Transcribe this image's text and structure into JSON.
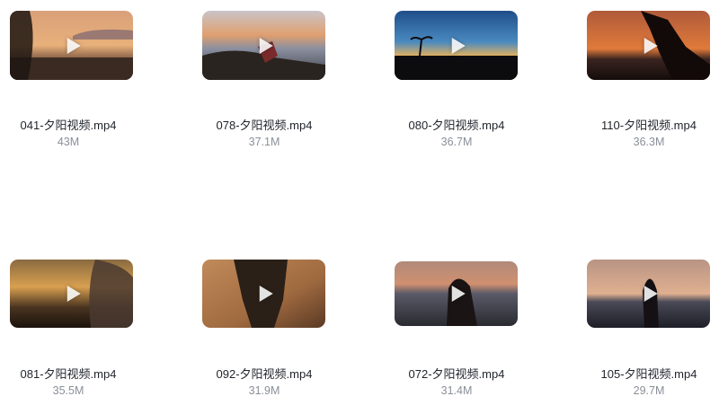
{
  "videos": [
    {
      "name": "041-夕阳视频.mp4",
      "size": "43M"
    },
    {
      "name": "078-夕阳视频.mp4",
      "size": "37.1M"
    },
    {
      "name": "080-夕阳视频.mp4",
      "size": "36.7M"
    },
    {
      "name": "110-夕阳视频.mp4",
      "size": "36.3M"
    },
    {
      "name": "081-夕阳视频.mp4",
      "size": "35.5M"
    },
    {
      "name": "092-夕阳视频.mp4",
      "size": "31.9M"
    },
    {
      "name": "072-夕阳视频.mp4",
      "size": "31.4M"
    },
    {
      "name": "105-夕阳视频.mp4",
      "size": "29.7M"
    }
  ],
  "icons": {
    "play": "play-icon"
  }
}
